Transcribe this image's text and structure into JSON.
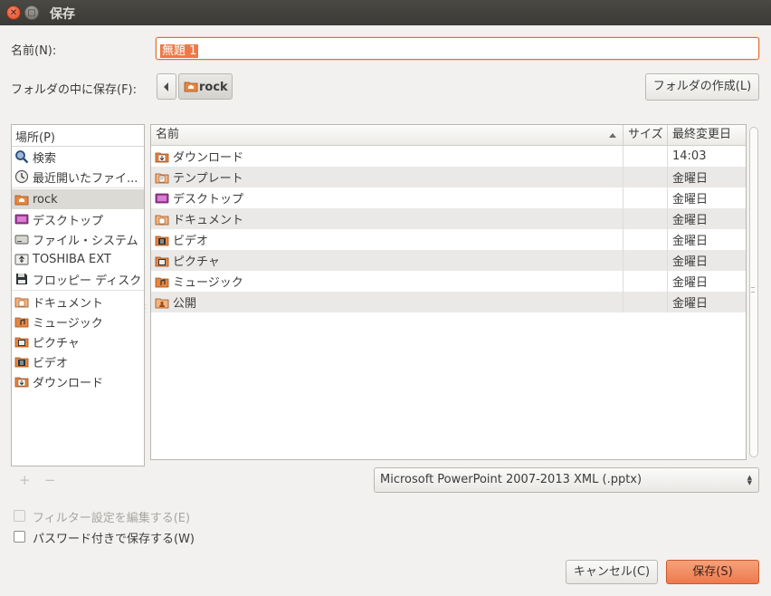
{
  "window": {
    "title": "保存"
  },
  "name_label": "名前(N):",
  "name_value": "無題 1",
  "folder_label": "フォルダの中に保存(F):",
  "path": {
    "current": "rock"
  },
  "create_folder_label": "フォルダの作成(L)",
  "places": {
    "header": "場所(P)",
    "items": [
      {
        "label": "検索",
        "icon": "search-icon"
      },
      {
        "label": "最近開いたファイ...",
        "icon": "recent-icon"
      },
      {
        "label": "rock",
        "icon": "home-folder-icon"
      },
      {
        "label": "デスクトップ",
        "icon": "desktop-icon"
      },
      {
        "label": "ファイル・システム",
        "icon": "drive-icon"
      },
      {
        "label": "TOSHIBA EXT",
        "icon": "usb-icon"
      },
      {
        "label": "フロッピー ディスク",
        "icon": "floppy-icon"
      },
      {
        "label": "ドキュメント",
        "icon": "documents-folder-icon"
      },
      {
        "label": "ミュージック",
        "icon": "music-folder-icon"
      },
      {
        "label": "ピクチャ",
        "icon": "pictures-folder-icon"
      },
      {
        "label": "ビデオ",
        "icon": "videos-folder-icon"
      },
      {
        "label": "ダウンロード",
        "icon": "downloads-folder-icon"
      }
    ]
  },
  "files": {
    "columns": {
      "name": "名前",
      "size": "サイズ",
      "modified": "最終変更日"
    },
    "rows": [
      {
        "name": "ダウンロード",
        "size": "",
        "modified": "14:03",
        "icon": "downloads-folder-icon"
      },
      {
        "name": "テンプレート",
        "size": "",
        "modified": "金曜日",
        "icon": "templates-folder-icon"
      },
      {
        "name": "デスクトップ",
        "size": "",
        "modified": "金曜日",
        "icon": "desktop-icon"
      },
      {
        "name": "ドキュメント",
        "size": "",
        "modified": "金曜日",
        "icon": "documents-folder-icon"
      },
      {
        "name": "ビデオ",
        "size": "",
        "modified": "金曜日",
        "icon": "videos-folder-icon"
      },
      {
        "name": "ピクチャ",
        "size": "",
        "modified": "金曜日",
        "icon": "pictures-folder-icon"
      },
      {
        "name": "ミュージック",
        "size": "",
        "modified": "金曜日",
        "icon": "music-folder-icon"
      },
      {
        "name": "公開",
        "size": "",
        "modified": "金曜日",
        "icon": "public-folder-icon"
      }
    ]
  },
  "add_label": "+",
  "remove_label": "−",
  "file_type": "Microsoft PowerPoint 2007-2013 XML (.pptx)",
  "options": {
    "edit_filter": "フィルター設定を編集する(E)",
    "password": "パスワード付きで保存する(W)"
  },
  "buttons": {
    "cancel": "キャンセル(C)",
    "save": "保存(S)"
  },
  "colors": {
    "accent": "#f07746",
    "titlebar": "#3e3d39",
    "selection": "#dcdad5"
  }
}
